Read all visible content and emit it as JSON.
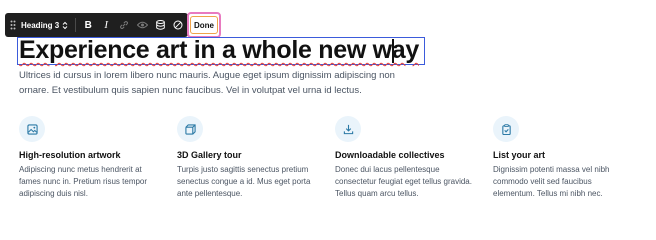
{
  "toolbar": {
    "heading_label": "Heading 3",
    "buttons": [
      {
        "icon": "bold-icon",
        "glyph": "B"
      },
      {
        "icon": "italic-icon",
        "glyph": "I"
      },
      {
        "icon": "link-icon"
      },
      {
        "icon": "visibility-icon"
      },
      {
        "icon": "database-icon"
      },
      {
        "icon": "clear-format-icon"
      }
    ],
    "done_label": "Done"
  },
  "heading": {
    "text": "Experience art in a whole new way"
  },
  "intro": {
    "text": "Ultrices id cursus in lorem libero nunc mauris. Augue eget ipsum dignissim adipiscing non ornare. Et vestibulum quis sapien nunc faucibus. Vel in volutpat vel urna id lectus."
  },
  "features": [
    {
      "icon": "image-icon",
      "title": "High-resolution artwork",
      "text": "Adipiscing nunc metus hendrerit at fames nunc in. Pretium risus tempor adipiscing duis nisl."
    },
    {
      "icon": "cube-icon",
      "title": "3D Gallery tour",
      "text": "Turpis justo sagittis senectus pretium senectus congue a id. Mus eget porta ante pellentesque."
    },
    {
      "icon": "download-icon",
      "title": "Downloadable collectives",
      "text": "Donec dui lacus pellentesque consectetur feugiat eget tellus gravida. Tellus quam arcu tellus."
    },
    {
      "icon": "clipboard-check-icon",
      "title": "List your art",
      "text": "Dignissim potenti massa vel nibh commodo velit sed faucibus elementum. Tellus mi nibh nec."
    }
  ],
  "colors": {
    "accent": "#3b5bdb",
    "toolbar_bg": "#1f1f1f",
    "icon_bg": "#eaf4fb",
    "icon_fg": "#2c7aa6",
    "done_outline": "#e87ac0"
  }
}
